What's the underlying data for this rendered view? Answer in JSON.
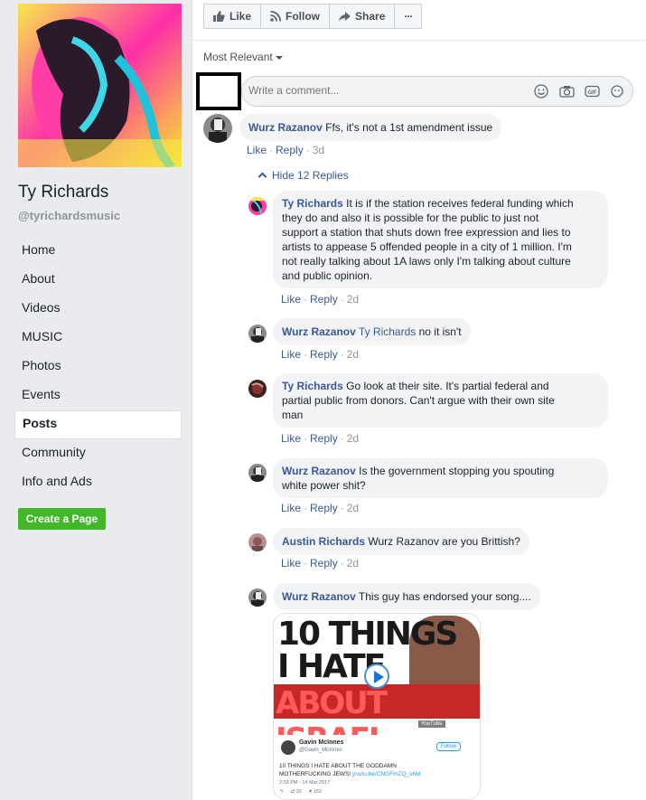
{
  "sidebar": {
    "page_name": "Ty Richards",
    "handle": "@tyrichardsmusic",
    "nav_items": [
      {
        "label": "Home"
      },
      {
        "label": "About"
      },
      {
        "label": "Videos"
      },
      {
        "label": "MUSIC"
      },
      {
        "label": "Photos"
      },
      {
        "label": "Events"
      },
      {
        "label": "Posts",
        "active": true
      },
      {
        "label": "Community"
      },
      {
        "label": "Info and Ads"
      }
    ],
    "create_page_label": "Create a Page"
  },
  "action_bar": {
    "like_label": "Like",
    "follow_label": "Follow",
    "share_label": "Share",
    "more_label": "···"
  },
  "sort": {
    "label": "Most Relevant"
  },
  "composer": {
    "placeholder": "Write a comment..."
  },
  "comments": [
    {
      "author": "Wurz Razanov",
      "text": "Ffs, it's not a 1st amendment issue",
      "like": "Like",
      "reply": "Reply",
      "time": "3d"
    }
  ],
  "hide_replies_label": "Hide 12 Replies",
  "replies": [
    {
      "author": "Ty Richards",
      "mention": "",
      "text_lines": [
        "It is if the station receives federal funding which",
        "they do and also it is possible for the public to just not",
        "support a station that shuts down free expression and lies to",
        "artists to appease 5 offended people in a city of 1 million. I'm",
        "not really talking about 1A laws only I'm talking about culture",
        "and public opinion."
      ],
      "like": "Like",
      "reply": "Reply",
      "time": "2d"
    },
    {
      "author": "Wurz Razanov",
      "mention": "Ty Richards",
      "text_lines": [
        "no it isn't"
      ],
      "like": "Like",
      "reply": "Reply",
      "time": "2d"
    },
    {
      "author": "Ty Richards",
      "mention": "",
      "text_lines": [
        "Go look at their site. It's partial federal and",
        "partial public from donors. Can't argue with their own site",
        "man"
      ],
      "like": "Like",
      "reply": "Reply",
      "time": "2d"
    },
    {
      "author": "Wurz Razanov",
      "mention": "",
      "text_lines": [
        "Is the government stopping you spouting",
        "white power shit?"
      ],
      "like": "Like",
      "reply": "Reply",
      "time": "2d"
    },
    {
      "author": "Austin Richards",
      "mention": "",
      "text_lines": [
        "Wurz Razanov are you Brittish?"
      ],
      "like": "Like",
      "reply": "Reply",
      "time": "2d"
    },
    {
      "author": "Wurz Razanov",
      "mention": "",
      "text_lines": [
        "This guy has endorsed your song...."
      ],
      "like": "",
      "reply": "",
      "time": ""
    }
  ],
  "embed": {
    "thumb_line1": "10 THINGS",
    "thumb_line2": "I HATE",
    "thumb_line3": "ABOUT ISRAEL",
    "youtube_badge": "YouTube",
    "tweet_name": "Gavin McInnes",
    "tweet_handle": "@Gavin_McInnes",
    "tweet_follow": "Follow",
    "tweet_text_1": "10 THINGS I HATE ABOUT THE GODDAMN",
    "tweet_text_2": "MOTHERFUCKING JEWS!",
    "tweet_link": "youtu.be/CNGFmZQ_s6M",
    "tweet_date": "2:03 PM - 14 Mar 2017",
    "tweet_retweets": "32",
    "tweet_likes": "153"
  },
  "colors": {
    "link_blue": "#385898",
    "green": "#42b72a",
    "bubble_bg": "#f2f3f5"
  }
}
